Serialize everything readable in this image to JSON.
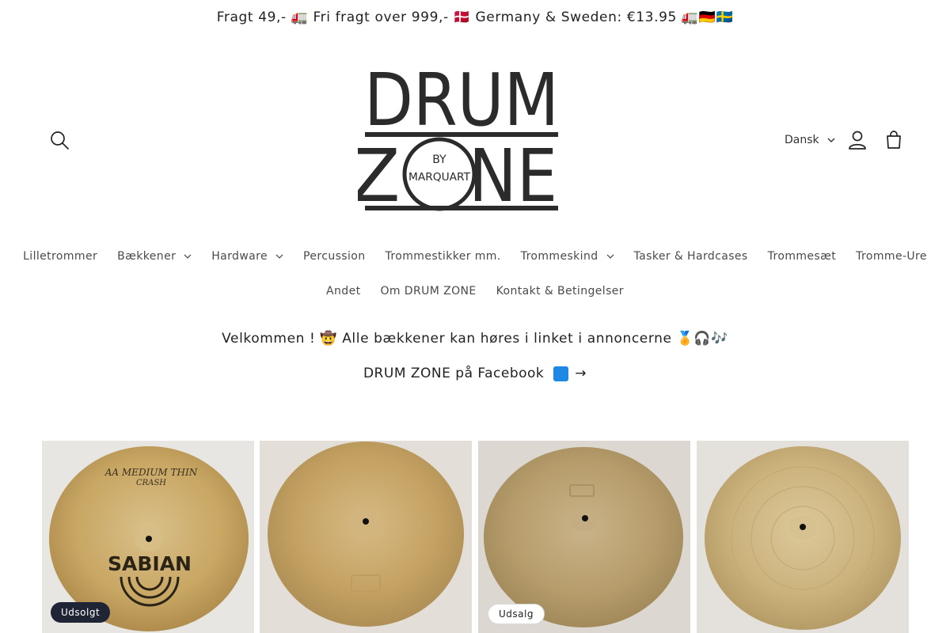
{
  "announcement": {
    "text": "Fragt 49,- 🚛 Fri fragt over 999,- 🇩🇰 Germany & Sweden: €13.95 🚛🇩🇪🇸🇪"
  },
  "header": {
    "logo": {
      "line1": "DRUM",
      "line2_left": "Z",
      "line2_right": "NE",
      "badge_top": "BY",
      "badge_bottom": "MARQUART"
    },
    "language": "Dansk",
    "icons": {
      "search": "search-icon",
      "account": "account-icon",
      "cart": "cart-icon"
    }
  },
  "nav": {
    "row1": [
      {
        "label": "Lilletrommer",
        "dropdown": false
      },
      {
        "label": "Bækkener",
        "dropdown": true
      },
      {
        "label": "Hardware",
        "dropdown": true
      },
      {
        "label": "Percussion",
        "dropdown": false
      },
      {
        "label": "Trommestikker mm.",
        "dropdown": false
      },
      {
        "label": "Trommeskind",
        "dropdown": true
      },
      {
        "label": "Tasker & Hardcases",
        "dropdown": false
      },
      {
        "label": "Trommesæt",
        "dropdown": false
      },
      {
        "label": "Tromme-Ure",
        "dropdown": false
      }
    ],
    "row2": [
      {
        "label": "Andet",
        "dropdown": false
      },
      {
        "label": "Om DRUM ZONE",
        "dropdown": false
      },
      {
        "label": "Kontakt & Betingelser",
        "dropdown": false
      }
    ]
  },
  "welcome": {
    "text": "Velkommen ! 🤠 Alle bækkener kan høres i linket i annoncerne 🏅🎧🎶"
  },
  "facebook_link": {
    "text": "DRUM ZONE på Facebook",
    "arrow": "→"
  },
  "products": [
    {
      "badge": "Udsolgt",
      "badge_style": "dark",
      "cymbal_text_top": "AA MEDIUM THIN",
      "cymbal_text_mid": "CRASH",
      "cymbal_brand": "SABIAN"
    },
    {
      "badge": "",
      "badge_style": "",
      "cymbal_text_top": "",
      "cymbal_text_mid": "",
      "cymbal_brand": ""
    },
    {
      "badge": "Udsalg",
      "badge_style": "light",
      "cymbal_text_top": "",
      "cymbal_text_mid": "",
      "cymbal_brand": ""
    },
    {
      "badge": "",
      "badge_style": "",
      "cymbal_text_top": "",
      "cymbal_text_mid": "",
      "cymbal_brand": ""
    }
  ],
  "colors": {
    "text": "#121212",
    "badge_dark": "#1f2535",
    "logo": "#2b2b2b"
  }
}
